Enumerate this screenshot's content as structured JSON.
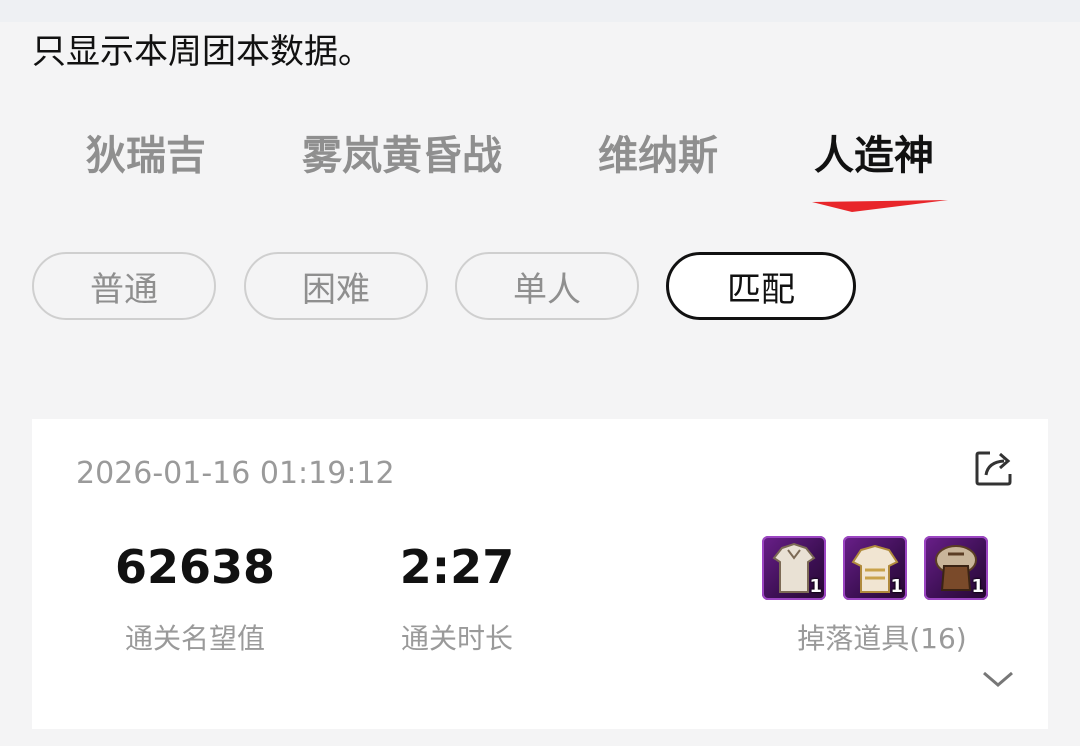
{
  "notice": "只显示本周团本数据。",
  "raid_tabs": [
    {
      "label": "狄瑞吉",
      "active": false
    },
    {
      "label": "雾岚黄昏战",
      "active": false
    },
    {
      "label": "维纳斯",
      "active": false
    },
    {
      "label": "人造神",
      "active": true
    }
  ],
  "difficulty_chips": [
    {
      "label": "普通",
      "active": false
    },
    {
      "label": "困难",
      "active": false
    },
    {
      "label": "单人",
      "active": false
    },
    {
      "label": "匹配",
      "active": true
    }
  ],
  "record": {
    "timestamp": "2026-01-16 01:19:12",
    "fame": {
      "value": "62638",
      "label": "通关名望值"
    },
    "duration": {
      "value": "2:27",
      "label": "通关时长"
    },
    "drops": {
      "label": "掉落道具(16)",
      "items": [
        {
          "icon": "cloth-armor-icon",
          "count": "1"
        },
        {
          "icon": "chest-armor-icon",
          "count": "1"
        },
        {
          "icon": "fur-armor-icon",
          "count": "1"
        }
      ]
    }
  },
  "colors": {
    "accent_red": "#e8262a",
    "active_text": "#111111",
    "inactive_text": "#8f8f8f",
    "item_purple": "#6a1f8a"
  }
}
